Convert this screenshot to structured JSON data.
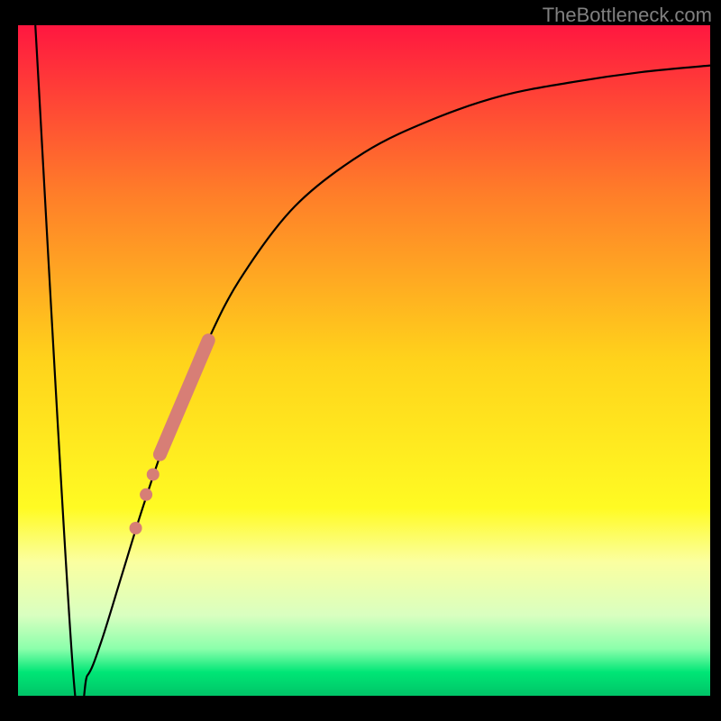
{
  "watermark": "TheBottleneck.com",
  "chart_data": {
    "type": "line",
    "title": "",
    "xlabel": "",
    "ylabel": "",
    "xlim": [
      0,
      100
    ],
    "ylim": [
      0,
      100
    ],
    "curve": {
      "name": "bottleneck-curve",
      "points": [
        {
          "x": 2.5,
          "y": 100
        },
        {
          "x": 8.0,
          "y": 3
        },
        {
          "x": 10.0,
          "y": 3
        },
        {
          "x": 12.0,
          "y": 8
        },
        {
          "x": 15.0,
          "y": 18
        },
        {
          "x": 18.0,
          "y": 28
        },
        {
          "x": 22.0,
          "y": 40
        },
        {
          "x": 27.0,
          "y": 52
        },
        {
          "x": 32.0,
          "y": 62
        },
        {
          "x": 40.0,
          "y": 73
        },
        {
          "x": 50.0,
          "y": 81
        },
        {
          "x": 60.0,
          "y": 86
        },
        {
          "x": 70.0,
          "y": 89.5
        },
        {
          "x": 80.0,
          "y": 91.5
        },
        {
          "x": 90.0,
          "y": 93
        },
        {
          "x": 100.0,
          "y": 94
        }
      ]
    },
    "highlight_band": {
      "name": "highlight-segment",
      "color": "#d77e76",
      "points": [
        {
          "x": 20.5,
          "y": 36
        },
        {
          "x": 27.5,
          "y": 53
        }
      ]
    },
    "highlight_dots": {
      "name": "highlight-dots",
      "color": "#d77e76",
      "points": [
        {
          "x": 18.5,
          "y": 30
        },
        {
          "x": 19.5,
          "y": 33
        },
        {
          "x": 17.0,
          "y": 25
        }
      ]
    },
    "gradient_stops": [
      {
        "offset": 0.0,
        "color": "#ff1740"
      },
      {
        "offset": 0.25,
        "color": "#ff7d29"
      },
      {
        "offset": 0.5,
        "color": "#ffd31b"
      },
      {
        "offset": 0.72,
        "color": "#fffb23"
      },
      {
        "offset": 0.8,
        "color": "#fbffa0"
      },
      {
        "offset": 0.88,
        "color": "#d9ffc0"
      },
      {
        "offset": 0.93,
        "color": "#8bffab"
      },
      {
        "offset": 0.965,
        "color": "#00e676"
      },
      {
        "offset": 1.0,
        "color": "#00c467"
      }
    ]
  }
}
